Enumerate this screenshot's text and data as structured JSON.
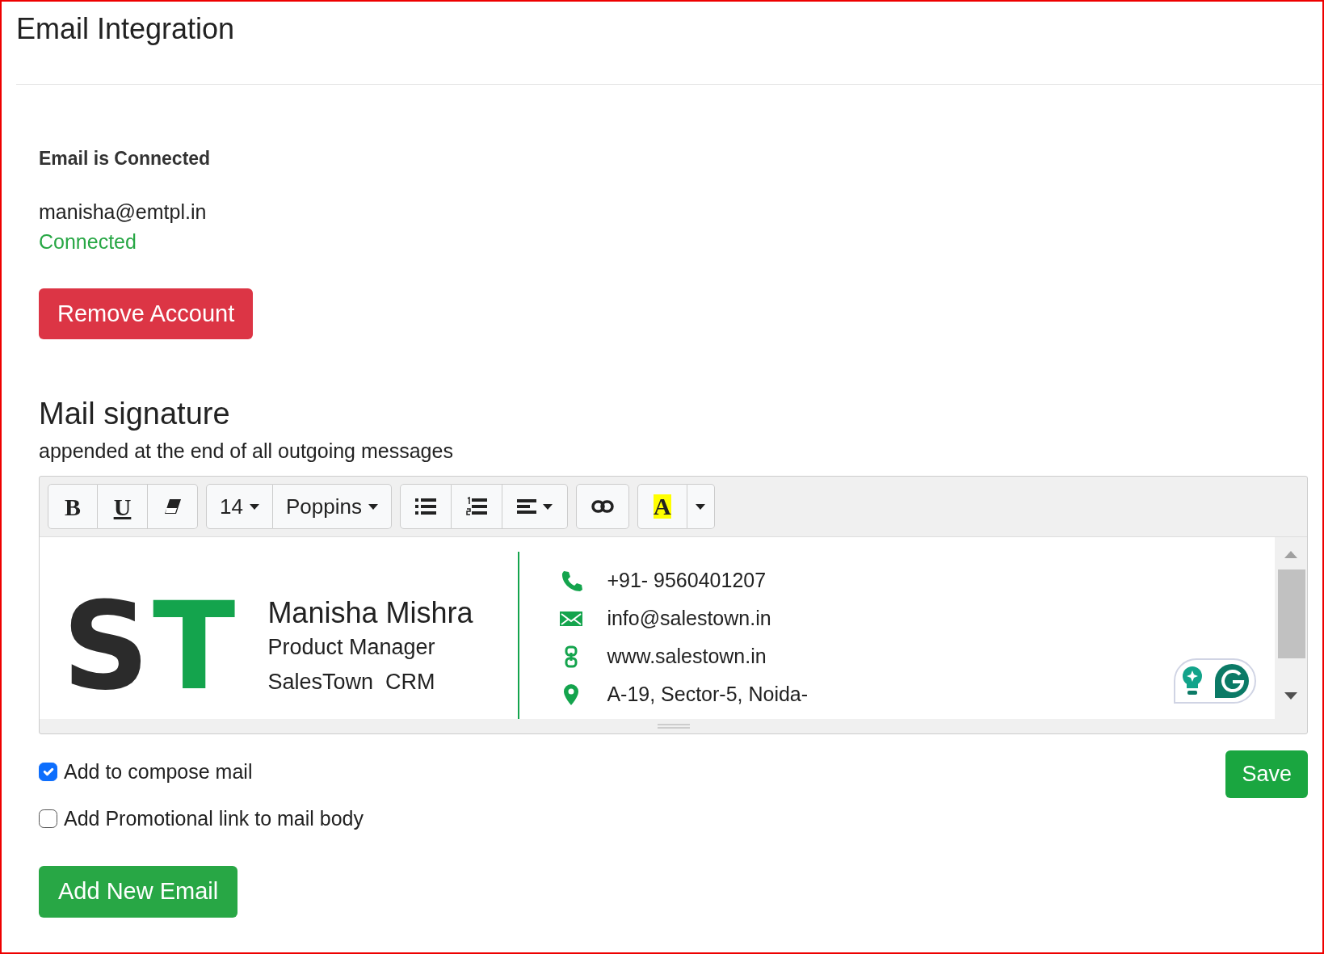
{
  "page": {
    "title": "Email Integration"
  },
  "account": {
    "heading": "Email is Connected",
    "email": "manisha@emtpl.in",
    "status": "Connected",
    "remove_button": "Remove Account"
  },
  "signature": {
    "title": "Mail signature",
    "subtitle": "appended at the end of all outgoing messages",
    "toolbar": [
      [
        {
          "kind": "bold",
          "label": "B"
        },
        {
          "kind": "underline",
          "label": "U"
        },
        {
          "kind": "eraser"
        }
      ],
      [
        {
          "kind": "dropdown",
          "label": "14"
        },
        {
          "kind": "dropdown",
          "label": "Poppins"
        }
      ],
      [
        {
          "kind": "bullets"
        },
        {
          "kind": "numbers"
        },
        {
          "kind": "align"
        }
      ],
      [
        {
          "kind": "link"
        }
      ],
      [
        {
          "kind": "highlight",
          "label": "A",
          "color": "#ffff00"
        },
        {
          "kind": "caret"
        }
      ]
    ],
    "content": {
      "logo": [
        {
          "letter": "S",
          "color": "#2b2b2b"
        },
        {
          "letter": "T",
          "color": "#14a44d"
        }
      ],
      "name": "Manisha Mishra",
      "role": "Product Manager",
      "company": "SalesTown  CRM",
      "contacts": [
        "+91- 9560401207",
        "info@salestown.in",
        "www.salestown.in",
        "A-19, Sector-5, Noida-"
      ]
    }
  },
  "options": [
    {
      "label": "Add to compose mail",
      "checked": true
    },
    {
      "label": "Add Promotional link to mail body",
      "checked": false
    }
  ],
  "save_button": "Save",
  "add_button": "Add New Email"
}
